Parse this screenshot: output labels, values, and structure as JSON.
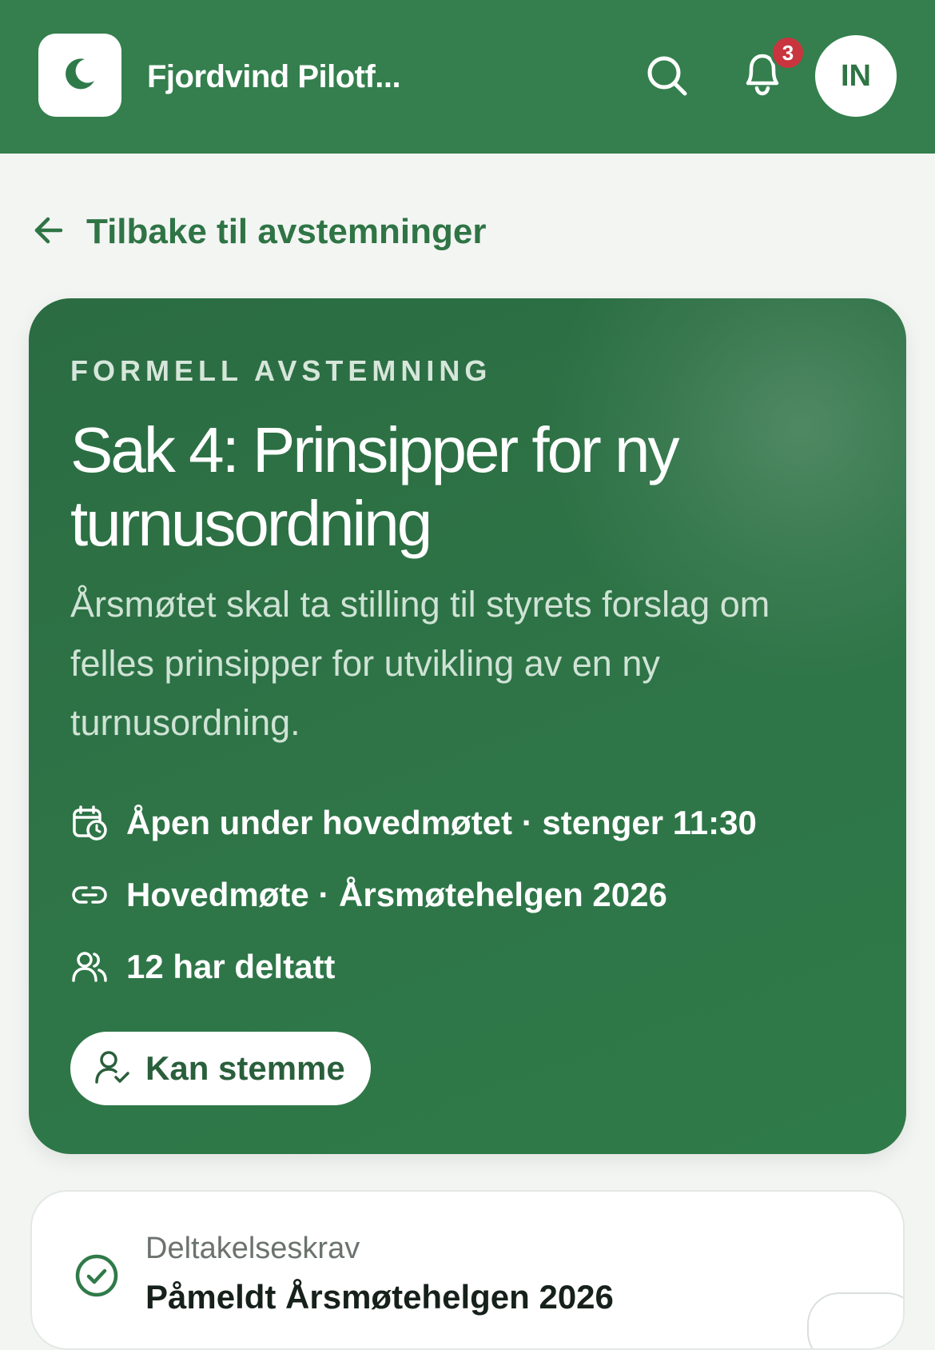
{
  "header": {
    "app_title": "Fjordvind Pilotf...",
    "logo_icon": "moon-icon",
    "search_icon": "search-icon",
    "notifications_icon": "bell-icon",
    "notification_count": "3",
    "avatar_initials": "IN",
    "brand_color": "#347f4d",
    "badge_color": "#c8353e"
  },
  "back_link": {
    "label": "Tilbake til avstemninger",
    "icon": "arrow-left-icon"
  },
  "vote": {
    "kicker": "FORMELL AVSTEMNING",
    "title": "Sak 4: Prinsipper for ny turnusordning",
    "description": "Årsmøtet skal ta stilling til styrets forslag om felles prinsipper for utvikling av en ny turnusordning.",
    "meta": [
      {
        "icon": "calendar-clock-icon",
        "text": "Åpen under hovedmøtet · stenger 11:30"
      },
      {
        "icon": "link-icon",
        "text": "Hovedmøte · Årsmøtehelgen 2026"
      },
      {
        "icon": "users-icon",
        "text": "12 har deltatt"
      }
    ],
    "status": {
      "icon": "user-check-icon",
      "label": "Kan stemme"
    }
  },
  "requirement": {
    "icon": "check-circle-icon",
    "label": "Deltakelseskrav",
    "value": "Påmeldt Årsmøtehelgen 2026"
  }
}
